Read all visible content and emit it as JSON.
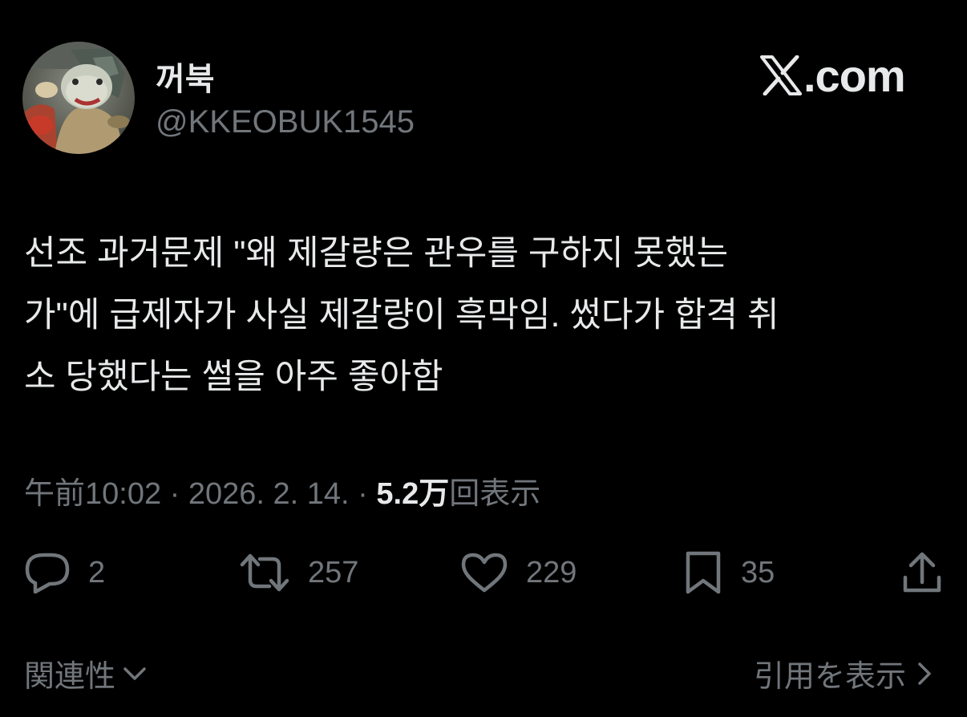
{
  "author": {
    "display_name": "꺼북",
    "handle": "@KKEOBUK1545",
    "avatar_icon": "turtle-avatar"
  },
  "brand": {
    "logo_icon": "x-logo-icon",
    "label": ".com"
  },
  "tweet": {
    "text": "선조 과거문제 \"왜 제갈량은 관우를 구하지 못했는\n가\"에 급제자가 사실 제갈량이 흑막임. 썼다가 합격 취\n소 당했다는 썰을 아주 좋아함"
  },
  "meta": {
    "time": "午前10:02",
    "separator1": " · ",
    "date": "2026. 2. 14.",
    "separator2": " · ",
    "views_count": "5.2万",
    "views_label": "回表示"
  },
  "actions": {
    "reply": {
      "icon": "reply-icon",
      "count": "2"
    },
    "retweet": {
      "icon": "retweet-icon",
      "count": "257"
    },
    "like": {
      "icon": "heart-icon",
      "count": "229"
    },
    "bookmark": {
      "icon": "bookmark-icon",
      "count": "35"
    },
    "share": {
      "icon": "share-icon"
    }
  },
  "footer": {
    "related_label": "関連性",
    "quotes_label": "引用を表示"
  },
  "colors": {
    "background": "#000000",
    "text_primary": "#e7e9ea",
    "text_secondary": "#71767b"
  }
}
